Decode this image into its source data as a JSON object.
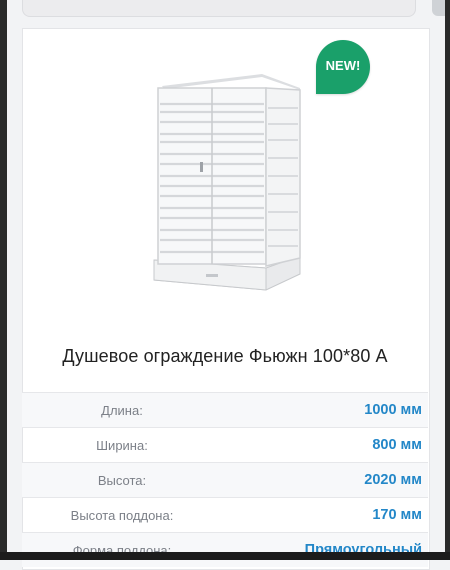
{
  "badge": {
    "label": "NEW!"
  },
  "product": {
    "title": "Душевое ограждение Фьюжн 100*80 А"
  },
  "specs": [
    {
      "label": "Длина:",
      "value": "1000 мм"
    },
    {
      "label": "Ширина:",
      "value": "800 мм"
    },
    {
      "label": "Высота:",
      "value": "2020 мм"
    },
    {
      "label": "Высота поддона:",
      "value": "170 мм"
    },
    {
      "label": "Форма поддона:",
      "value": "Прямоугольный"
    }
  ],
  "colors": {
    "accent_value": "#2387c8",
    "badge": "#1aa06a"
  }
}
